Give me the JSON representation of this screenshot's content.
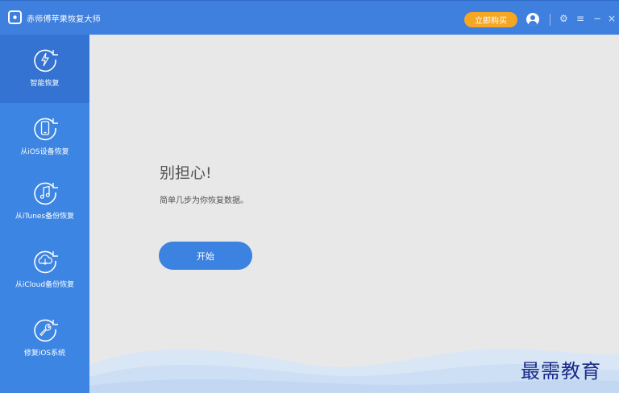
{
  "app": {
    "title": "赤师傅苹果恢复大师",
    "buy_label": "立即购买"
  },
  "titlebar_icons": {
    "settings": "⚙",
    "menu": "≡",
    "minimize": "−",
    "close": "×"
  },
  "sidebar": {
    "items": [
      {
        "label": "智能恢复",
        "icon": "lightning-recover-icon",
        "active": true
      },
      {
        "label": "从iOS设备恢复",
        "icon": "phone-recover-icon",
        "active": false
      },
      {
        "label": "从iTunes备份恢复",
        "icon": "music-recover-icon",
        "active": false
      },
      {
        "label": "从iCloud备份恢复",
        "icon": "cloud-recover-icon",
        "active": false
      },
      {
        "label": "修复iOS系统",
        "icon": "wrench-icon",
        "active": false
      }
    ]
  },
  "main": {
    "heading": "别担心!",
    "subtext": "简单几步为你恢复数据。",
    "start_label": "开始"
  },
  "watermark": "最需教育",
  "colors": {
    "titlebar": "#3f7fdd",
    "sidebar": "#3d85e2",
    "sidebar_active": "#3473d2",
    "accent_button": "#3c82e0",
    "buy_button": "#f5a623"
  }
}
